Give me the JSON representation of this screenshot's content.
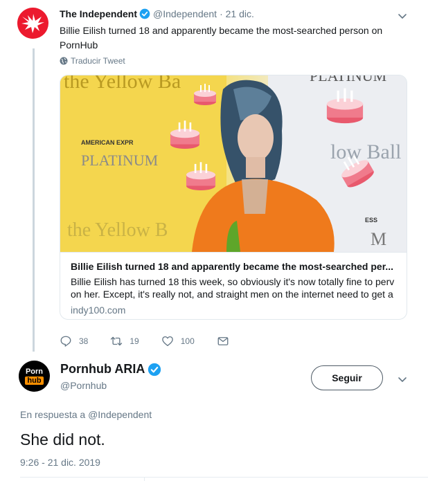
{
  "tweet1": {
    "author_name": "The Independent",
    "handle": "@Independent",
    "date": "· 21 dic.",
    "text": "Billie Eilish turned 18 and apparently became the most-searched person on PornHub",
    "translate_label": "Traducir Tweet",
    "card": {
      "title": "Billie Eilish turned 18 and apparently became the most-searched per...",
      "description": "Billie Eilish has turned 18 this week, so obviously it's now totally fine to perv on her. Except, it's really not, and straight men on the internet need to get a",
      "domain": "indy100.com",
      "bg_text_1": "the Yellow Ba",
      "bg_text_2": "AMERICAN EXPR",
      "bg_text_3": "PLATINUM",
      "bg_text_4": "the Yellow B",
      "bg_text_5": "PLATINUM",
      "bg_text_6": "low Ball",
      "bg_text_7": "ESS",
      "bg_text_8": "M"
    },
    "actions": {
      "replies": "38",
      "retweets": "19",
      "likes": "100"
    }
  },
  "tweet2": {
    "avatar_top": "Porn",
    "avatar_bottom": "hub",
    "author_name": "Pornhub ARIA",
    "handle": "@Pornhub",
    "follow_label": "Seguir",
    "reply_prefix": "En respuesta a ",
    "reply_mention": "@Independent",
    "text": "She did not.",
    "timestamp": "9:26 - 21 dic. 2019"
  },
  "colors": {
    "verified": "#1da1f2",
    "muted": "#657786",
    "independent_red": "#ec1a2e",
    "pornhub_orange": "#ff9000"
  }
}
